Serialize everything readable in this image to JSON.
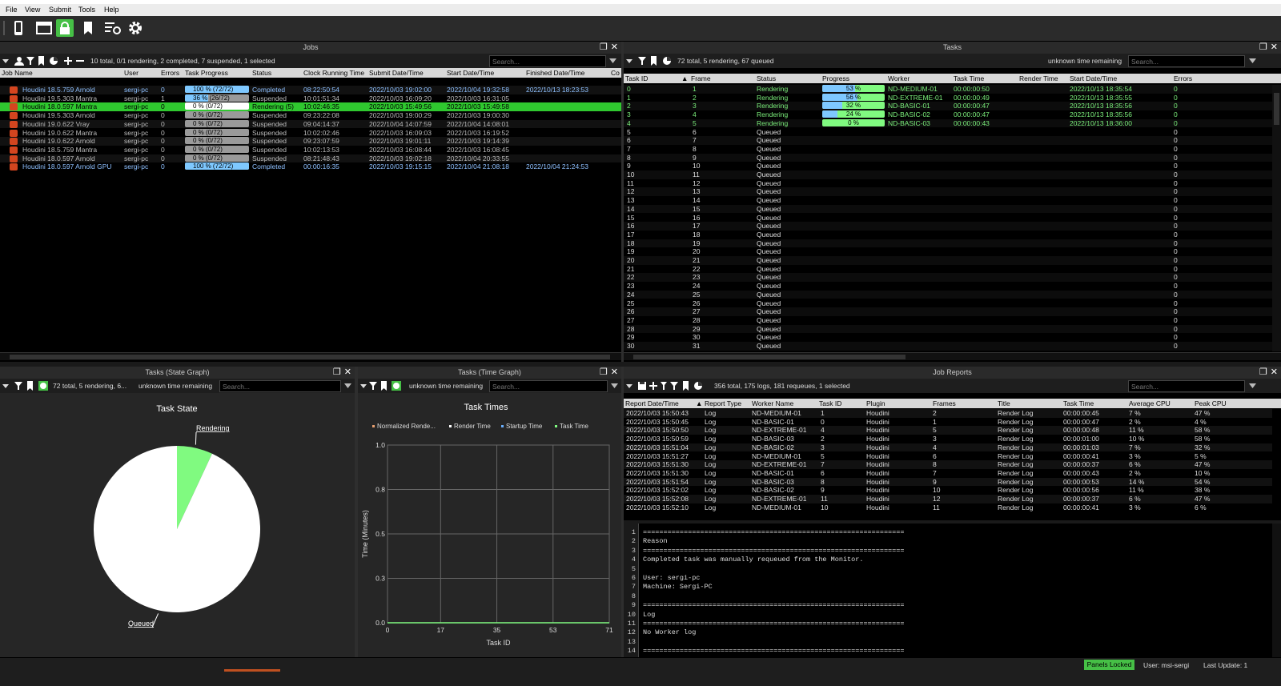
{
  "menu": [
    "File",
    "View",
    "Submit",
    "Tools",
    "Help"
  ],
  "jobs_panel": {
    "title": "Jobs",
    "summary": "10 total, 0/1 rendering, 2 completed, 7 suspended, 1 selected",
    "search_placeholder": "Search...",
    "columns": [
      "Job Name",
      "User",
      "Errors",
      "Task Progress",
      "Status",
      "Clock Running Time",
      "Submit Date/Time",
      "Start Date/Time",
      "Finished Date/Time",
      "Co"
    ],
    "rows": [
      {
        "name": "Houdini 18.5.759 Arnold",
        "user": "sergi-pc",
        "errors": "0",
        "progress": "100 %  (72/72)",
        "fill": 1.0,
        "status": "Completed",
        "clock": "08:22:50:54",
        "submit": "2022/10/03 19:02:00",
        "start": "2022/10/04 19:32:58",
        "finished": "2022/10/13 18:23:53",
        "style": "completed"
      },
      {
        "name": "Houdini 19.5.303 Mantra",
        "user": "sergi-pc",
        "errors": "1",
        "progress": "36 %  (26/72)",
        "fill": 0.36,
        "status": "Suspended",
        "clock": "10:01:51:34",
        "submit": "2022/10/03 16:09:20",
        "start": "2022/10/03 16:31:05",
        "finished": "",
        "style": "suspended"
      },
      {
        "name": "Houdini 18.0.597 Mantra",
        "user": "sergi-pc",
        "errors": "0",
        "progress": "0 %  (0/72)",
        "fill": 0.0,
        "status": "Rendering (5)",
        "clock": "10:02:46:35",
        "submit": "2022/10/03 15:49:56",
        "start": "2022/10/03 15:49:58",
        "finished": "",
        "style": "selected"
      },
      {
        "name": "Houdini 19.5.303 Arnold",
        "user": "sergi-pc",
        "errors": "0",
        "progress": "0 %  (0/72)",
        "fill": 0.0,
        "status": "Suspended",
        "clock": "09:23:22:08",
        "submit": "2022/10/03 19:00:29",
        "start": "2022/10/03 19:00:30",
        "finished": "",
        "style": "suspended"
      },
      {
        "name": "Houdini 19.0.622 Vray",
        "user": "sergi-pc",
        "errors": "0",
        "progress": "0 %  (0/72)",
        "fill": 0.0,
        "status": "Suspended",
        "clock": "09:04:14:37",
        "submit": "2022/10/04 14:07:59",
        "start": "2022/10/04 14:08:01",
        "finished": "",
        "style": "suspended"
      },
      {
        "name": "Houdini 19.0.622 Mantra",
        "user": "sergi-pc",
        "errors": "0",
        "progress": "0 %  (0/72)",
        "fill": 0.0,
        "status": "Suspended",
        "clock": "10:02:02:46",
        "submit": "2022/10/03 16:09:03",
        "start": "2022/10/03 16:19:52",
        "finished": "",
        "style": "suspended"
      },
      {
        "name": "Houdini 19.0.622 Arnold",
        "user": "sergi-pc",
        "errors": "0",
        "progress": "0 %  (0/72)",
        "fill": 0.0,
        "status": "Suspended",
        "clock": "09:23:07:59",
        "submit": "2022/10/03 19:01:11",
        "start": "2022/10/03 19:14:39",
        "finished": "",
        "style": "suspended"
      },
      {
        "name": "Houdini 18.5.759 Mantra",
        "user": "sergi-pc",
        "errors": "0",
        "progress": "0 %  (0/72)",
        "fill": 0.0,
        "status": "Suspended",
        "clock": "10:02:13:53",
        "submit": "2022/10/03 16:08:44",
        "start": "2022/10/03 16:08:45",
        "finished": "",
        "style": "suspended"
      },
      {
        "name": "Houdini 18.0.597 Arnold",
        "user": "sergi-pc",
        "errors": "0",
        "progress": "0 %  (0/72)",
        "fill": 0.0,
        "status": "Suspended",
        "clock": "08:21:48:43",
        "submit": "2022/10/03 19:02:18",
        "start": "2022/10/04 20:33:55",
        "finished": "",
        "style": "suspended"
      },
      {
        "name": "Houdini 18.0.597 Arnold GPU",
        "user": "sergi-pc",
        "errors": "0",
        "progress": "100 %  (72/72)",
        "fill": 1.0,
        "status": "Completed",
        "clock": "00:00:16:35",
        "submit": "2022/10/03 19:15:15",
        "start": "2022/10/04 21:08:18",
        "finished": "2022/10/04 21:24:53",
        "style": "completed"
      }
    ]
  },
  "tasks_panel": {
    "title": "Tasks",
    "summary": "72 total, 5 rendering, 67 queued",
    "remaining": "unknown time remaining",
    "search_placeholder": "Search...",
    "columns": [
      "Task ID",
      "Frame",
      "Status",
      "Progress",
      "Worker",
      "Task Time",
      "Render Time",
      "Start Date/Time",
      "Errors"
    ],
    "rendering": [
      {
        "id": "0",
        "frame": "1",
        "status": "Rendering",
        "progress": "53 %",
        "fill": 0.53,
        "worker": "ND-MEDIUM-01",
        "time": "00:00:00:50",
        "start": "2022/10/13 18:35:54",
        "errors": "0"
      },
      {
        "id": "1",
        "frame": "2",
        "status": "Rendering",
        "progress": "56 %",
        "fill": 0.56,
        "worker": "ND-EXTREME-01",
        "time": "00:00:00:49",
        "start": "2022/10/13 18:35:55",
        "errors": "0"
      },
      {
        "id": "2",
        "frame": "3",
        "status": "Rendering",
        "progress": "32 %",
        "fill": 0.32,
        "worker": "ND-BASIC-01",
        "time": "00:00:00:47",
        "start": "2022/10/13 18:35:56",
        "errors": "0"
      },
      {
        "id": "3",
        "frame": "4",
        "status": "Rendering",
        "progress": "24 %",
        "fill": 0.24,
        "worker": "ND-BASIC-02",
        "time": "00:00:00:47",
        "start": "2022/10/13 18:35:56",
        "errors": "0"
      },
      {
        "id": "4",
        "frame": "5",
        "status": "Rendering",
        "progress": "0 %",
        "fill": 0.0,
        "worker": "ND-BASIC-03",
        "time": "00:00:00:43",
        "start": "2022/10/13 18:36:00",
        "errors": "0"
      }
    ],
    "queued_status": "Queued",
    "queued_ids": [
      "5",
      "6",
      "7",
      "8",
      "9",
      "10",
      "11",
      "12",
      "13",
      "14",
      "15",
      "16",
      "17",
      "18",
      "19",
      "20",
      "21",
      "22",
      "23",
      "24",
      "25",
      "26",
      "27",
      "28",
      "29",
      "30"
    ],
    "queued_frames": [
      "6",
      "7",
      "8",
      "9",
      "10",
      "11",
      "12",
      "13",
      "14",
      "15",
      "16",
      "17",
      "18",
      "19",
      "20",
      "21",
      "22",
      "23",
      "24",
      "25",
      "26",
      "27",
      "28",
      "29",
      "30",
      "31"
    ],
    "queued_errors": "0"
  },
  "state_graph": {
    "title": "Tasks (State Graph)",
    "summary": "72 total, 5 rendering, 6...",
    "remaining": "unknown time remaining",
    "search_placeholder": "Search...",
    "chart_title": "Task State",
    "chart_data": {
      "type": "pie",
      "slices": [
        {
          "label": "Rendering",
          "value": 5,
          "color": "#80fa80"
        },
        {
          "label": "Queued",
          "value": 67,
          "color": "#ffffff"
        }
      ]
    }
  },
  "time_graph": {
    "title": "Tasks (Time Graph)",
    "remaining": "unknown time remaining",
    "search_placeholder": "Search...",
    "chart_title": "Task Times",
    "chart_data": {
      "type": "line",
      "legend": [
        "Normalized Rende...",
        "Render Time",
        "Startup Time",
        "Task Time"
      ],
      "legend_colors": [
        "#e8a070",
        "#ffffff",
        "#6ab0ff",
        "#80fa80"
      ],
      "xlabel": "Task ID",
      "ylabel": "Time (Minutes)",
      "xticks": [
        "0",
        "17",
        "35",
        "53",
        "71"
      ],
      "yticks": [
        "0.0",
        "0.3",
        "0.5",
        "0.8",
        "1.0"
      ],
      "xlim": [
        0,
        71
      ],
      "ylim": [
        0,
        1.0
      ],
      "series": [
        {
          "name": "Task Time",
          "x": [
            0,
            71
          ],
          "y": [
            0,
            0
          ],
          "color": "#80fa80"
        }
      ]
    }
  },
  "job_reports": {
    "title": "Job Reports",
    "summary": "356 total, 175 logs, 181 requeues, 1 selected",
    "search_placeholder": "Search...",
    "columns": [
      "Report Date/Time",
      "Report Type",
      "Worker Name",
      "Task ID",
      "Plugin",
      "Frames",
      "Title",
      "Task Time",
      "Average CPU",
      "Peak CPU"
    ],
    "rows": [
      [
        "2022/10/03 15:50:43",
        "Log",
        "ND-MEDIUM-01",
        "1",
        "Houdini",
        "2",
        "Render Log",
        "00:00:00:45",
        "7 %",
        "47 %"
      ],
      [
        "2022/10/03 15:50:45",
        "Log",
        "ND-BASIC-01",
        "0",
        "Houdini",
        "1",
        "Render Log",
        "00:00:00:47",
        "2 %",
        "4 %"
      ],
      [
        "2022/10/03 15:50:50",
        "Log",
        "ND-EXTREME-01",
        "4",
        "Houdini",
        "5",
        "Render Log",
        "00:00:00:48",
        "11 %",
        "58 %"
      ],
      [
        "2022/10/03 15:50:59",
        "Log",
        "ND-BASIC-03",
        "2",
        "Houdini",
        "3",
        "Render Log",
        "00:00:01:00",
        "10 %",
        "58 %"
      ],
      [
        "2022/10/03 15:51:04",
        "Log",
        "ND-BASIC-02",
        "3",
        "Houdini",
        "4",
        "Render Log",
        "00:00:01:03",
        "7 %",
        "32 %"
      ],
      [
        "2022/10/03 15:51:27",
        "Log",
        "ND-MEDIUM-01",
        "5",
        "Houdini",
        "6",
        "Render Log",
        "00:00:00:41",
        "3 %",
        "5 %"
      ],
      [
        "2022/10/03 15:51:30",
        "Log",
        "ND-EXTREME-01",
        "7",
        "Houdini",
        "8",
        "Render Log",
        "00:00:00:37",
        "6 %",
        "47 %"
      ],
      [
        "2022/10/03 15:51:30",
        "Log",
        "ND-BASIC-01",
        "6",
        "Houdini",
        "7",
        "Render Log",
        "00:00:00:43",
        "2 %",
        "10 %"
      ],
      [
        "2022/10/03 15:51:54",
        "Log",
        "ND-BASIC-03",
        "8",
        "Houdini",
        "9",
        "Render Log",
        "00:00:00:53",
        "14 %",
        "54 %"
      ],
      [
        "2022/10/03 15:52:02",
        "Log",
        "ND-BASIC-02",
        "9",
        "Houdini",
        "10",
        "Render Log",
        "00:00:00:56",
        "11 %",
        "38 %"
      ],
      [
        "2022/10/03 15:52:08",
        "Log",
        "ND-EXTREME-01",
        "11",
        "Houdini",
        "12",
        "Render Log",
        "00:00:00:37",
        "6 %",
        "47 %"
      ],
      [
        "2022/10/03 15:52:10",
        "Log",
        "ND-MEDIUM-01",
        "10",
        "Houdini",
        "11",
        "Render Log",
        "00:00:00:41",
        "3 %",
        "6 %"
      ]
    ],
    "log_lines": [
      {
        "n": "1",
        "t": "================================================================"
      },
      {
        "n": "2",
        "t": "Reason"
      },
      {
        "n": "3",
        "t": "================================================================"
      },
      {
        "n": "4",
        "t": "Completed task was manually requeued from the Monitor."
      },
      {
        "n": "5",
        "t": ""
      },
      {
        "n": "6",
        "t": "User: sergi-pc"
      },
      {
        "n": "7",
        "t": "Machine: Sergi-PC"
      },
      {
        "n": "8",
        "t": ""
      },
      {
        "n": "9",
        "t": "================================================================"
      },
      {
        "n": "10",
        "t": "Log"
      },
      {
        "n": "11",
        "t": "================================================================"
      },
      {
        "n": "12",
        "t": "No Worker log"
      },
      {
        "n": "13",
        "t": ""
      },
      {
        "n": "14",
        "t": "================================================================"
      }
    ]
  },
  "statusbar": {
    "panels_locked": "Panels Locked",
    "user": "User: msi-sergi",
    "last_update": "Last Update: 1"
  }
}
